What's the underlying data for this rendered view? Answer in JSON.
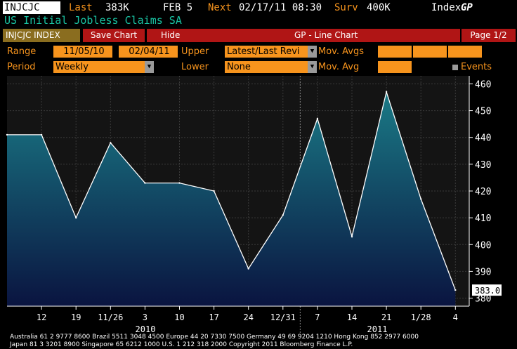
{
  "header": {
    "ticker": "INJCJC",
    "last_label": "Last",
    "last_value": "383K",
    "date": "FEB 5",
    "next_label": "Next",
    "next_value": "02/17/11 08:30",
    "surv_label": "Surv",
    "surv_value": "400K",
    "index_label": "Index",
    "gp": "GP",
    "subtitle": "US Initial Jobless Claims SA"
  },
  "tabs": {
    "index_tab": "INJCJC INDEX",
    "save_chart": "Save Chart",
    "hide": "Hide",
    "chart_title": "GP - Line Chart",
    "page": "Page 1/2"
  },
  "controls": {
    "range_label": "Range",
    "range_start": "11/05/10",
    "range_end": "02/04/11",
    "upper_label": "Upper",
    "upper_value": "Latest/Last Revi",
    "mov_avgs_label": "Mov. Avgs",
    "period_label": "Period",
    "period_value": "Weekly",
    "lower_label": "Lower",
    "lower_value": "None",
    "mov_avg_label": "Mov. Avg",
    "events_label": "Events"
  },
  "footer": {
    "line1": "Australia 61 2 9777 8600 Brazil 5511 3048 4500 Europe 44 20 7330 7500 Germany 49 69 9204 1210 Hong Kong 852 2977 6000",
    "line2": "Japan 81 3 3201 8900          Singapore 65 6212 1000          U.S. 1 212 318 2000          Copyright 2011 Bloomberg Finance L.P."
  },
  "chart_data": {
    "type": "area",
    "x": [
      "11/05/10",
      "11/12/10",
      "11/19/10",
      "11/26/10",
      "12/03/10",
      "12/10/10",
      "12/17/10",
      "12/24/10",
      "12/31/10",
      "01/07/11",
      "01/14/11",
      "01/21/11",
      "01/28/11",
      "02/04/11"
    ],
    "values": [
      441,
      441,
      410,
      438,
      423,
      423,
      420,
      391,
      411,
      447,
      403,
      457,
      417,
      383
    ],
    "ylim": [
      377,
      463
    ],
    "yticks": [
      380,
      390,
      400,
      410,
      420,
      430,
      440,
      450,
      460
    ],
    "xtick_labels": [
      "12",
      "19",
      "11/26",
      "3",
      "10",
      "17",
      "24",
      "12/31",
      "7",
      "14",
      "21",
      "1/28",
      "4"
    ],
    "year_labels": [
      "2010",
      "2011"
    ],
    "last_value_label": "383.0",
    "grid": true,
    "colors": {
      "line": "#ffffff",
      "fill_top": "#1a7a86",
      "fill_bottom": "#0a1440",
      "background": "#141414"
    }
  }
}
